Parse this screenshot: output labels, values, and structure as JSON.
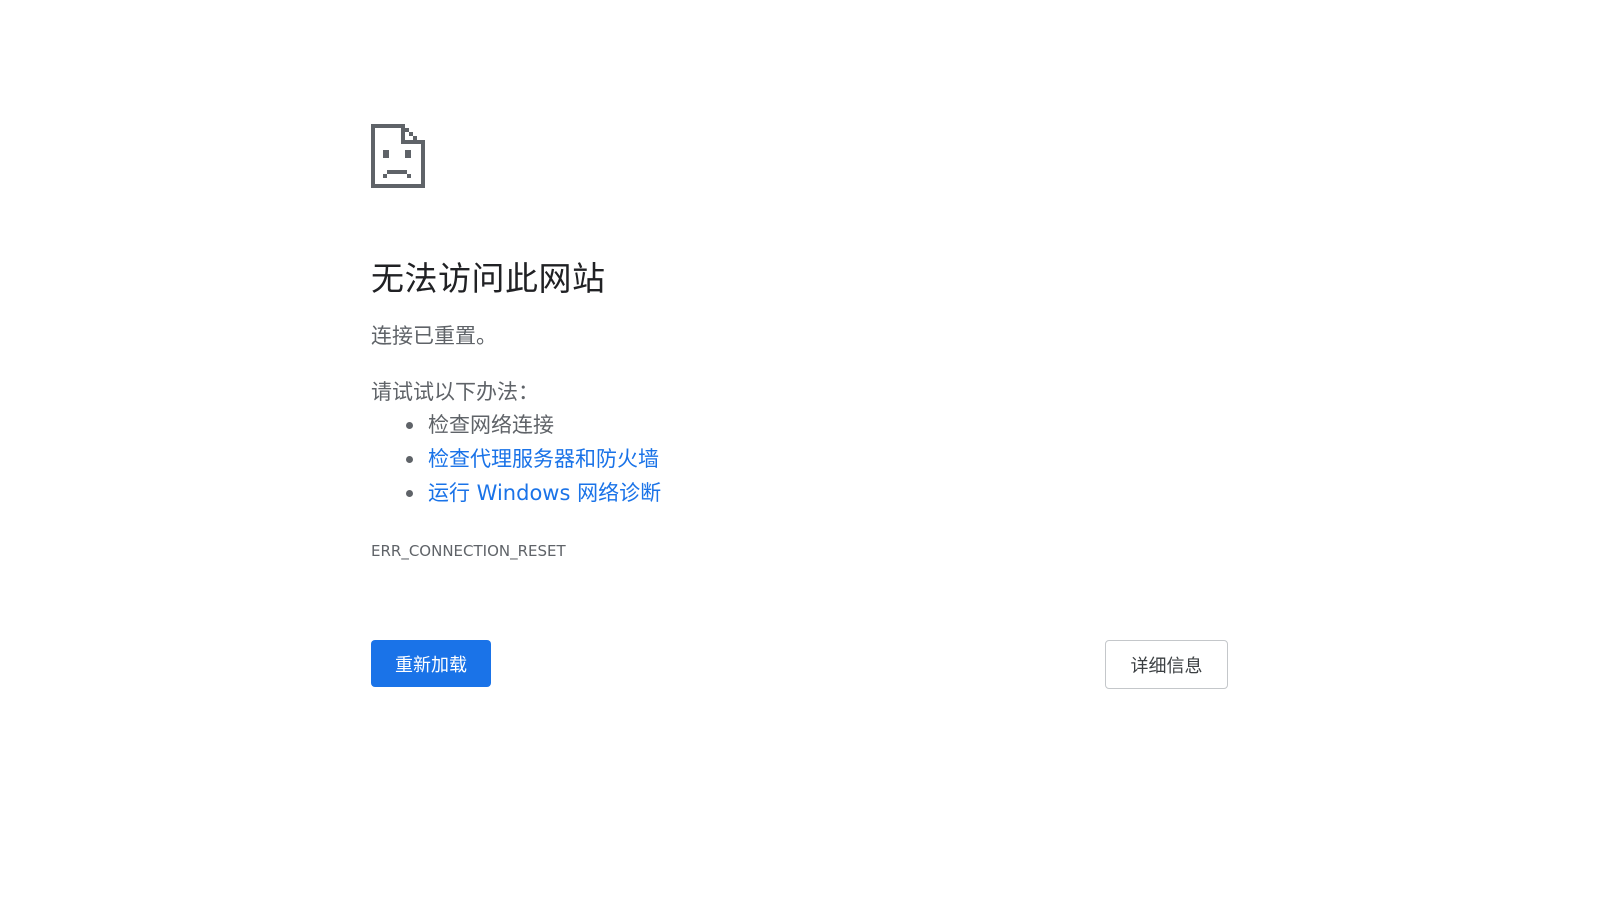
{
  "error_page": {
    "icon": "sad-document-icon",
    "title": "无法访问此网站",
    "summary": "连接已重置。",
    "suggestions_heading": "请试试以下办法：",
    "suggestions": [
      {
        "label": "检查网络连接",
        "is_link": false
      },
      {
        "label": "检查代理服务器和防火墙",
        "is_link": true
      },
      {
        "label": "运行 Windows 网络诊断",
        "is_link": true
      }
    ],
    "error_code": "ERR_CONNECTION_RESET"
  },
  "buttons": {
    "reload_label": "重新加载",
    "details_label": "详细信息"
  },
  "colors": {
    "primary_blue": "#1a73e8",
    "title_text": "#202124",
    "body_text": "#5f6368",
    "background": "#ffffff"
  }
}
